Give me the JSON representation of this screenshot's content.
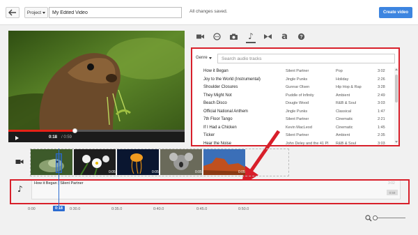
{
  "topbar": {
    "project_label": "Project",
    "title_value": "My Edited Video",
    "saved_status": "All changes saved.",
    "create_label": "Create video"
  },
  "player": {
    "current_time": "0:18",
    "total_time": "/ 0:59",
    "progress_fraction": 0.38
  },
  "tabs": [
    {
      "name": "video-camera-icon",
      "active": false
    },
    {
      "name": "creative-commons-icon",
      "active": false
    },
    {
      "name": "photo-camera-icon",
      "active": false
    },
    {
      "name": "music-note-icon",
      "active": true
    },
    {
      "name": "transitions-icon",
      "active": false
    },
    {
      "name": "text-icon",
      "active": false
    },
    {
      "name": "help-icon",
      "active": false
    }
  ],
  "audio": {
    "genre_label": "Genre",
    "search_placeholder": "Search audio tracks",
    "tracks": [
      {
        "title": "How it Began",
        "artist": "Silent Partner",
        "genre": "Pop",
        "duration": "3:02"
      },
      {
        "title": "Joy to the World (Instrumental)",
        "artist": "Jingle Punks",
        "genre": "Holiday",
        "duration": "2:26"
      },
      {
        "title": "Shoulder Closures",
        "artist": "Gunnar Olsen",
        "genre": "Hip Hop & Rap",
        "duration": "3:28"
      },
      {
        "title": "They Might Not",
        "artist": "Puddle of Infinity",
        "genre": "Ambient",
        "duration": "2:49"
      },
      {
        "title": "Beach Disco",
        "artist": "Dougle Wood",
        "genre": "R&B & Soul",
        "duration": "3:03"
      },
      {
        "title": "Official National Anthem",
        "artist": "Jingle Punks",
        "genre": "Classical",
        "duration": "1:47"
      },
      {
        "title": "7th Floor Tango",
        "artist": "Silent Partner",
        "genre": "Cinematic",
        "duration": "2:21"
      },
      {
        "title": "If I Had a Chicken",
        "artist": "Kevin MacLeod",
        "genre": "Cinematic",
        "duration": "1:45"
      },
      {
        "title": "Ticker",
        "artist": "Silent Partner",
        "genre": "Ambient",
        "duration": "2:35"
      },
      {
        "title": "Hear the Noise",
        "artist": "John Deley and the 41 Pl",
        "genre": "R&B & Soul",
        "duration": "3:03"
      }
    ]
  },
  "timeline": {
    "audio_clip_title": "How it Began",
    "audio_clip_artist": "Silent Partner",
    "audio_clip_end": "3:02",
    "audio_clip_length": "0:59",
    "playhead": "0:18",
    "ticks": [
      "0:00",
      "0:30.0",
      "0:35.0",
      "0:40.0",
      "0:45.0",
      "0:50.0"
    ]
  },
  "colors": {
    "accent_blue": "#3d85e0",
    "annotation_red": "#d81f2a",
    "progress_red": "#e62117"
  }
}
